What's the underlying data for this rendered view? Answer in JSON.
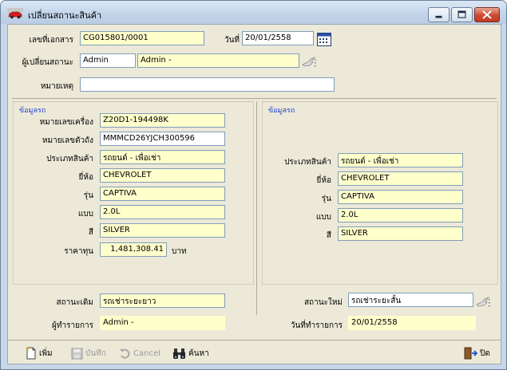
{
  "window": {
    "title": "เปลี่ยนสถานะสินค้า"
  },
  "header": {
    "doc_no_label": "เลขที่เอกสาร",
    "doc_no_value": "CG015801/0001",
    "date_label": "วันที่",
    "date_value": "20/01/2558",
    "changer_label": "ผู้เปลี่ยนสถานะ",
    "changer_code": "Admin",
    "changer_name": "Admin -",
    "note_label": "หมายเหตุ",
    "note_value": ""
  },
  "left_panel": {
    "title": "ข้อมูลรถ",
    "engine_label": "หมายเลขเครื่อง",
    "engine_value": "Z20D1-194498K",
    "chassis_label": "หมายเลขตัวถัง",
    "chassis_value": "MMMCD26YJCH300596",
    "type_label": "ประเภทสินค้า",
    "type_value": "รถยนต์ - เพื่อเช่า",
    "brand_label": "ยี่ห้อ",
    "brand_value": "CHEVROLET",
    "model_label": "รุ่น",
    "model_value": "CAPTIVA",
    "variant_label": "แบบ",
    "variant_value": "2.0L",
    "color_label": "สี",
    "color_value": "SILVER",
    "cost_label": "ราคาทุน",
    "cost_value": "1,481,308.41",
    "cost_unit": "บาท",
    "old_status_label": "สถานะเดิม",
    "old_status_value": "รถเช่าระยะยาว",
    "operator_label": "ผู้ทำรายการ",
    "operator_value": "Admin -"
  },
  "right_panel": {
    "title": "ข้อมูลรถ",
    "type_label": "ประเภทสินค้า",
    "type_value": "รถยนต์ - เพื่อเช่า",
    "brand_label": "ยี่ห้อ",
    "brand_value": "CHEVROLET",
    "model_label": "รุ่น",
    "model_value": "CAPTIVA",
    "variant_label": "แบบ",
    "variant_value": "2.0L",
    "color_label": "สี",
    "color_value": "SILVER",
    "new_status_label": "สถานะใหม่",
    "new_status_value": "รถเช่าระยะสั้น",
    "op_date_label": "วันที่ทำรายการ",
    "op_date_value": "20/01/2558"
  },
  "toolbar": {
    "add_label": "เพิ่ม",
    "save_label": "บันทึก",
    "cancel_label": "Cancel",
    "search_label": "ค้นหา",
    "close_label": "ปิด"
  },
  "colors": {
    "field_bg": "#ffffcc",
    "group_title": "#1a3fd6",
    "client_bg": "#ece9d8"
  }
}
